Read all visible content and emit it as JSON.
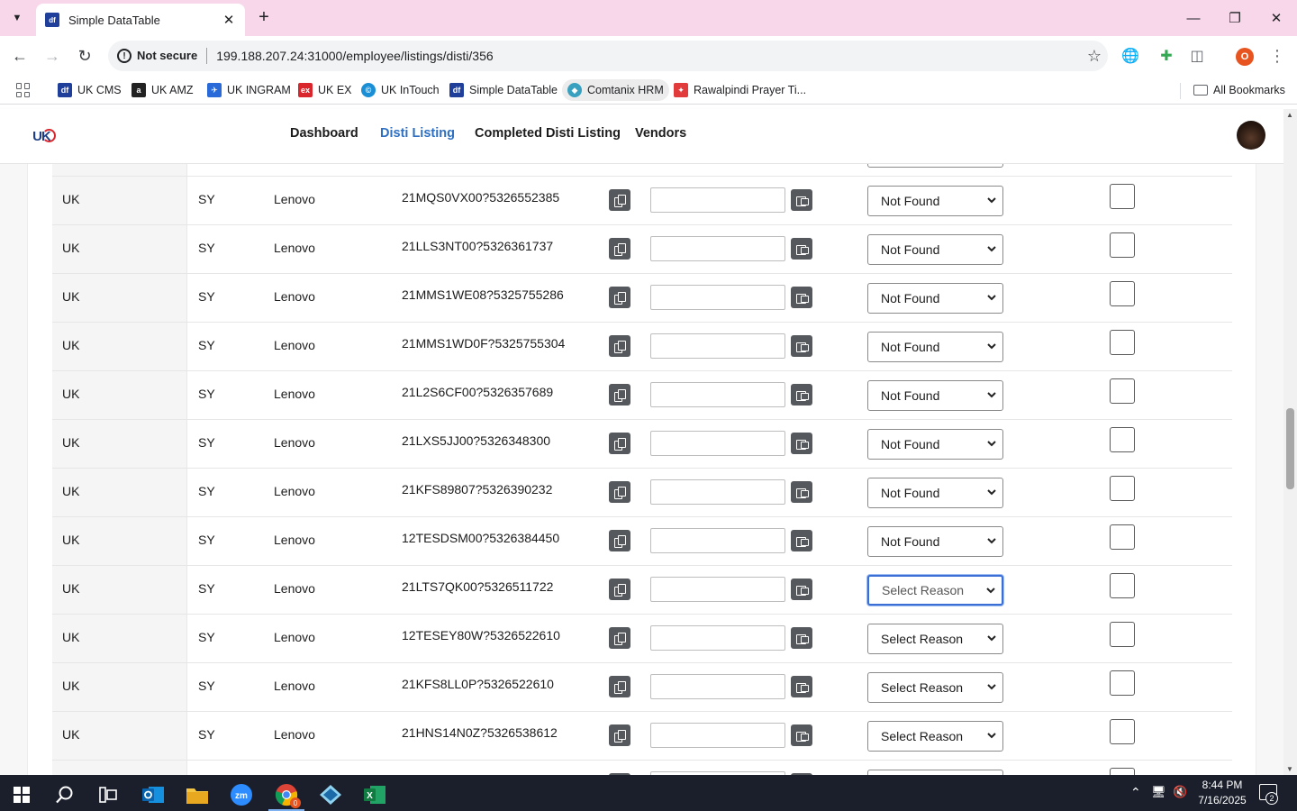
{
  "browser": {
    "tab_title": "Simple DataTable",
    "tab_favicon": "df",
    "security_label": "Not secure",
    "url": "199.188.207.24:31000/employee/listings/disti/356",
    "profile_initial": "O"
  },
  "bookmarks": [
    {
      "label": "UK CMS",
      "icon": "df-icon",
      "color": "#1f3f9a",
      "glyph": "df"
    },
    {
      "label": "UK AMZ",
      "icon": "amazon-icon",
      "color": "#222222",
      "glyph": "a"
    },
    {
      "label": "UK INGRAM",
      "icon": "ingram-icon",
      "color": "#2a6ad8",
      "glyph": "✈"
    },
    {
      "label": "UK EX",
      "icon": "ex-icon",
      "color": "#d9262d",
      "glyph": "ex"
    },
    {
      "label": "UK InTouch",
      "icon": "intouch-icon",
      "color": "#1a8fd6",
      "glyph": "©"
    },
    {
      "label": "Simple DataTable",
      "icon": "df-icon",
      "color": "#1f3f9a",
      "glyph": "df"
    },
    {
      "label": "Comtanix HRM",
      "icon": "comtanix-icon",
      "color": "#3aa0c0",
      "glyph": "◆"
    },
    {
      "label": "Rawalpindi Prayer Ti...",
      "icon": "prayer-icon",
      "color": "#e23b3b",
      "glyph": "✦"
    }
  ],
  "all_bookmarks_label": "All Bookmarks",
  "nav": {
    "items": [
      "Dashboard",
      "Disti Listing",
      "Completed Disti Listing",
      "Vendors"
    ],
    "active": "Disti Listing"
  },
  "rows": [
    {
      "country": "UK",
      "code": "SY",
      "brand": "Lenovo",
      "sku": "21MQS0VX00?5326552385",
      "reason": "Not Found"
    },
    {
      "country": "UK",
      "code": "SY",
      "brand": "Lenovo",
      "sku": "21LLS3NT00?5326361737",
      "reason": "Not Found"
    },
    {
      "country": "UK",
      "code": "SY",
      "brand": "Lenovo",
      "sku": "21MMS1WE08?5325755286",
      "reason": "Not Found"
    },
    {
      "country": "UK",
      "code": "SY",
      "brand": "Lenovo",
      "sku": "21MMS1WD0F?5325755304",
      "reason": "Not Found"
    },
    {
      "country": "UK",
      "code": "SY",
      "brand": "Lenovo",
      "sku": "21L2S6CF00?5326357689",
      "reason": "Not Found"
    },
    {
      "country": "UK",
      "code": "SY",
      "brand": "Lenovo",
      "sku": "21LXS5JJ00?5326348300",
      "reason": "Not Found"
    },
    {
      "country": "UK",
      "code": "SY",
      "brand": "Lenovo",
      "sku": "21KFS89807?5326390232",
      "reason": "Not Found"
    },
    {
      "country": "UK",
      "code": "SY",
      "brand": "Lenovo",
      "sku": "12TESDSM00?5326384450",
      "reason": "Not Found"
    },
    {
      "country": "UK",
      "code": "SY",
      "brand": "Lenovo",
      "sku": "21LTS7QK00?5326511722",
      "reason": "Select Reason"
    },
    {
      "country": "UK",
      "code": "SY",
      "brand": "Lenovo",
      "sku": "12TESEY80W?5326522610",
      "reason": "Select Reason"
    },
    {
      "country": "UK",
      "code": "SY",
      "brand": "Lenovo",
      "sku": "21KFS8LL0P?5326522610",
      "reason": "Select Reason"
    },
    {
      "country": "UK",
      "code": "SY",
      "brand": "Lenovo",
      "sku": "21HNS14N0Z?5326538612",
      "reason": "Select Reason"
    }
  ],
  "focused_row_index": 8,
  "taskbar": {
    "apps": [
      "windows-start",
      "search",
      "task-view",
      "outlook",
      "file-explorer",
      "zoom",
      "chrome",
      "app-diamond",
      "excel"
    ],
    "active_app": "chrome",
    "chrome_badge": "0"
  },
  "clock": {
    "time": "8:44 PM",
    "date": "7/16/2025"
  },
  "notification_count": "2",
  "colors": {
    "accent": "#2f6fc2",
    "tab_strip": "#f8d7ea",
    "button_dark": "#55595e",
    "focus": "#3b6fd6"
  }
}
